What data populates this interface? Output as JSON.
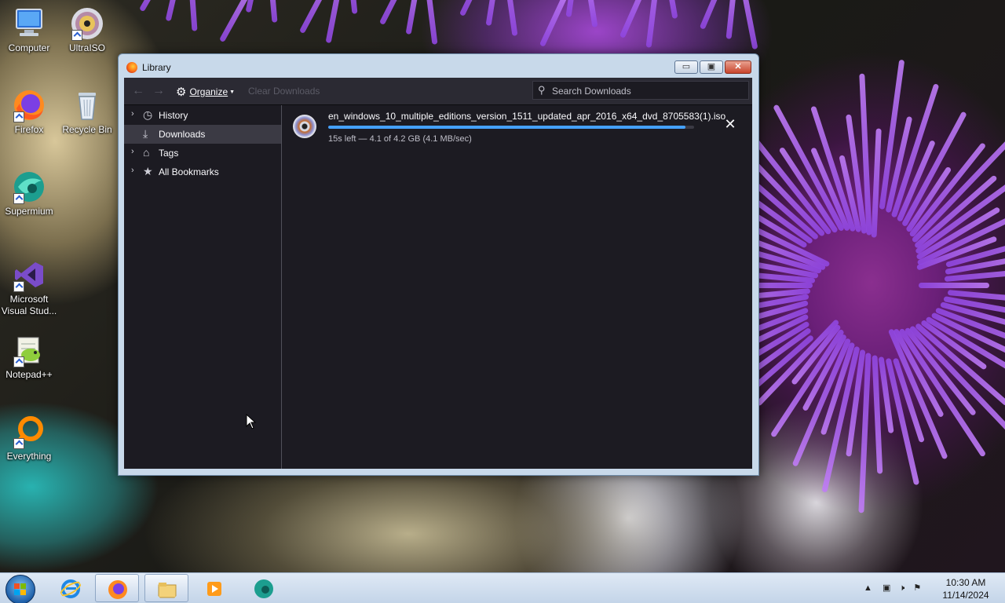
{
  "desktop": {
    "icons": [
      {
        "label": "Computer",
        "icon": "computer-icon"
      },
      {
        "label": "UltraISO",
        "icon": "disc-icon"
      },
      {
        "label": "Firefox",
        "icon": "firefox-icon"
      },
      {
        "label": "Recycle Bin",
        "icon": "recycle-bin-icon"
      },
      {
        "label": "Supermium",
        "icon": "supermium-icon"
      },
      {
        "label": "Microsoft Visual Stud...",
        "icon": "visual-studio-icon"
      },
      {
        "label": "Notepad++",
        "icon": "notepad-plus-icon"
      },
      {
        "label": "Everything",
        "icon": "everything-search-icon"
      }
    ]
  },
  "window": {
    "title": "Library",
    "buttons": {
      "minimize": "▭",
      "maximize": "▣",
      "close": "✕"
    }
  },
  "toolbar": {
    "back": "←",
    "forward": "→",
    "organize_label": "Organize",
    "clear_label": "Clear Downloads",
    "search_placeholder": "Search Downloads"
  },
  "sidebar": {
    "items": [
      {
        "label": "History",
        "expandable": true,
        "icon": "clock-icon"
      },
      {
        "label": "Downloads",
        "expandable": false,
        "icon": "download-icon",
        "selected": true
      },
      {
        "label": "Tags",
        "expandable": true,
        "icon": "tag-icon"
      },
      {
        "label": "All Bookmarks",
        "expandable": true,
        "icon": "star-icon"
      }
    ]
  },
  "downloads": [
    {
      "filename": "en_windows_10_multiple_editions_version_1511_updated_apr_2016_x64_dvd_8705583(1).iso",
      "status": "15s left — 4.1 of 4.2 GB (4.1 MB/sec)",
      "progress": 0.976
    }
  ],
  "taskbar": {
    "apps": [
      "internet-explorer-icon",
      "firefox-icon",
      "file-explorer-icon",
      "media-player-icon",
      "supermium-icon"
    ],
    "time": "10:30 AM",
    "date": "11/14/2024"
  },
  "colors": {
    "accent": "#45a1ff",
    "library_bg": "#1c1b22",
    "toolbar_bg": "#2b2a33"
  }
}
